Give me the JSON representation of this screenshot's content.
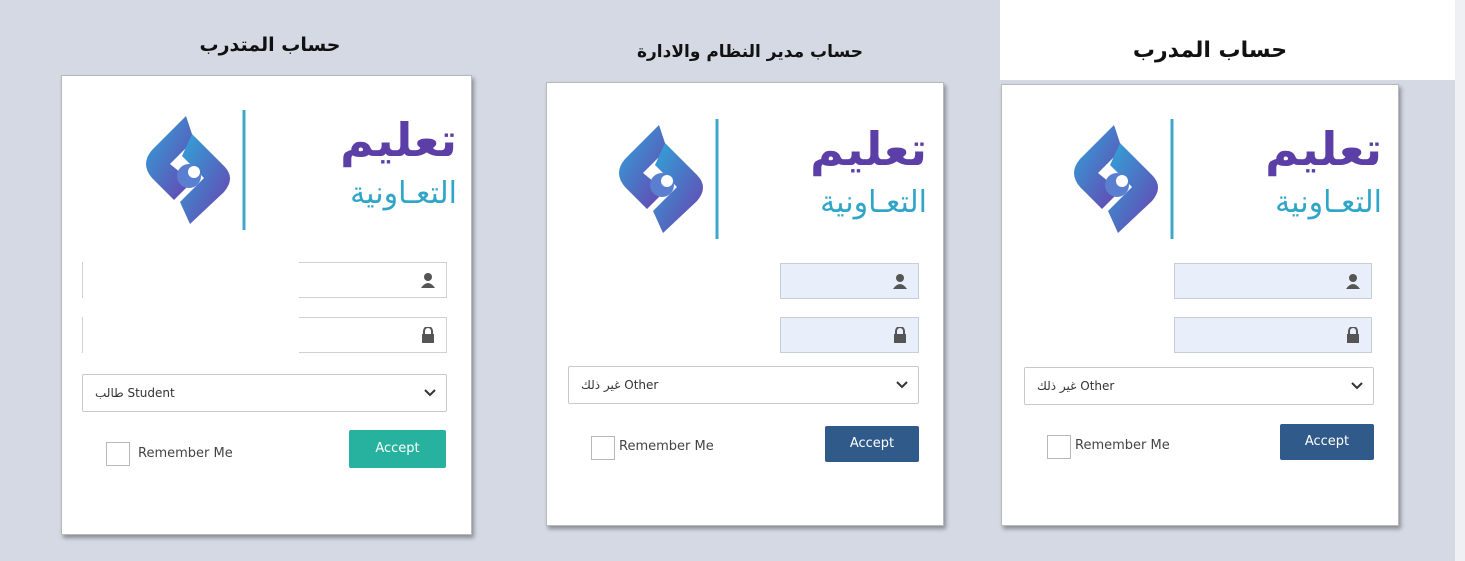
{
  "panels": [
    {
      "id": "trainee",
      "heading": "حساب المتدرب",
      "select_value": "طالب Student",
      "remember_label": "Remember Me",
      "accept_label": "Accept",
      "accept_color": "#26b29e",
      "field_style": "white"
    },
    {
      "id": "admin",
      "heading": "حساب مدير النظام والادارة",
      "select_value": "غير ذلك Other",
      "remember_label": "Remember Me",
      "accept_label": "Accept",
      "accept_color": "#2f5a8a",
      "field_style": "blue"
    },
    {
      "id": "trainer",
      "heading": "حساب المدرب",
      "select_value": "غير ذلك Other",
      "remember_label": "Remember Me",
      "accept_label": "Accept",
      "accept_color": "#2f5a8a",
      "field_style": "blue"
    }
  ],
  "logo": {
    "text_top": "تعليم",
    "text_bottom": "التعـاونية",
    "text_color_top": "#5b3fa6",
    "text_color_bottom": "#2fa6c8"
  },
  "icons": [
    "user-icon",
    "lock-icon",
    "chevron-down-icon",
    "logo-emblem-icon"
  ],
  "colors": {
    "background": "#d5d9e3",
    "field_fill": "#e8effb",
    "teal": "#26b29e",
    "navy": "#2f5a8a"
  }
}
